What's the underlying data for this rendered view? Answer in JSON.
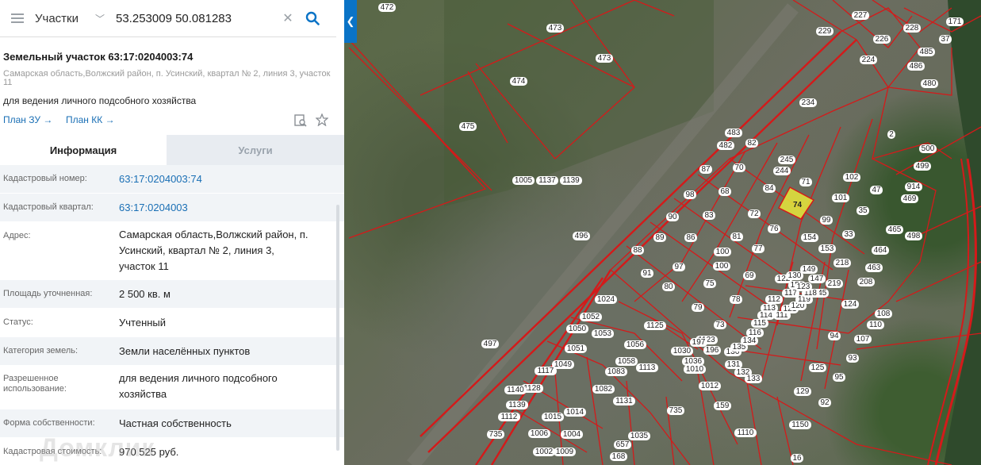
{
  "search": {
    "layer": "Участки",
    "query": "53.253009 50.081283",
    "menu_icon": "hamburger-icon",
    "clear_icon": "close-icon",
    "search_icon": "search-icon",
    "collapse_icon": "chevron-left-icon"
  },
  "panel": {
    "title": "Земельный участок 63:17:0204003:74",
    "address_line1": "Самарская область,Волжский район, п. Усинский, квартал № 2, линия 3, участок",
    "address_line2": "11",
    "purpose": "для ведения личного подсобного хозяйства",
    "link_plan_zu": "План ЗУ →",
    "link_plan_kk": "План КК →",
    "doc_icon": "document-search-icon",
    "star_icon": "star-icon"
  },
  "tabs": {
    "info": "Информация",
    "services": "Услуги"
  },
  "rows": [
    {
      "key": "Кадастровый номер:",
      "value": "63:17:0204003:74"
    },
    {
      "key": "Кадастровый квартал:",
      "value": "63:17:0204003"
    },
    {
      "key": "Адрес:",
      "value_lines": [
        "Самарская область,Волжский район, п.",
        "Усинский, квартал № 2, линия 3,",
        "участок 11"
      ]
    },
    {
      "key": "Площадь уточненная:",
      "value": "2 500 кв. м"
    },
    {
      "key": "Статус:",
      "value": "Учтенный"
    },
    {
      "key": "Категория земель:",
      "value": "Земли населённых пунктов"
    },
    {
      "key_lines": [
        "Разрешенное",
        "использование:"
      ],
      "value_lines": [
        "для ведения личного подсобного",
        "хозяйства"
      ]
    },
    {
      "key": "Форма собственности:",
      "value": "Частная собственность"
    },
    {
      "key": "Кадастровая стоимость:",
      "value": "970 525 руб."
    }
  ],
  "watermark": "Домклик",
  "colors": {
    "accent": "#0a73c6",
    "boundary": "#d41a1a",
    "selected_plot": "#e8e83a",
    "link": "#1a6fb5"
  },
  "map": {
    "selected_plot": "74",
    "labels": [
      "472",
      "473",
      "473",
      "474",
      "475",
      "229",
      "227",
      "226",
      "228",
      "37",
      "171",
      "224",
      "485",
      "486",
      "480",
      "234",
      "2",
      "483",
      "482",
      "82",
      "245",
      "244",
      "71",
      "102",
      "47",
      "87",
      "70",
      "98",
      "68",
      "84",
      "72",
      "101",
      "35",
      "90",
      "83",
      "99",
      "33",
      "89",
      "86",
      "81",
      "76",
      "154",
      "153",
      "465",
      "88",
      "97",
      "100",
      "100",
      "77",
      "218",
      "464",
      "463",
      "91",
      "80",
      "75",
      "69",
      "150",
      "149",
      "147",
      "145",
      "219",
      "208",
      "1024",
      "1050",
      "1052",
      "1053",
      "1051",
      "1049",
      "1117",
      "1125",
      "1128",
      "1140",
      "1139",
      "1112",
      "1056",
      "1058",
      "1113",
      "1083",
      "1082",
      "1131",
      "1030",
      "1036",
      "1010",
      "1012",
      "1015",
      "1014",
      "1006",
      "1004",
      "1009",
      "1002",
      "1123",
      "1110",
      "1150",
      "1035",
      "73",
      "79",
      "78",
      "197",
      "196",
      "131",
      "132",
      "133",
      "136",
      "135",
      "134",
      "116",
      "115",
      "114",
      "113",
      "112",
      "111",
      "121",
      "120",
      "119",
      "118",
      "117",
      "123",
      "122",
      "130",
      "129",
      "125",
      "124",
      "94",
      "93",
      "95",
      "92",
      "108",
      "110",
      "107",
      "500",
      "499",
      "914",
      "469",
      "498",
      "496",
      "497",
      "159",
      "735",
      "735",
      "16",
      "168",
      "657",
      "1005",
      "1137",
      "1139"
    ]
  }
}
